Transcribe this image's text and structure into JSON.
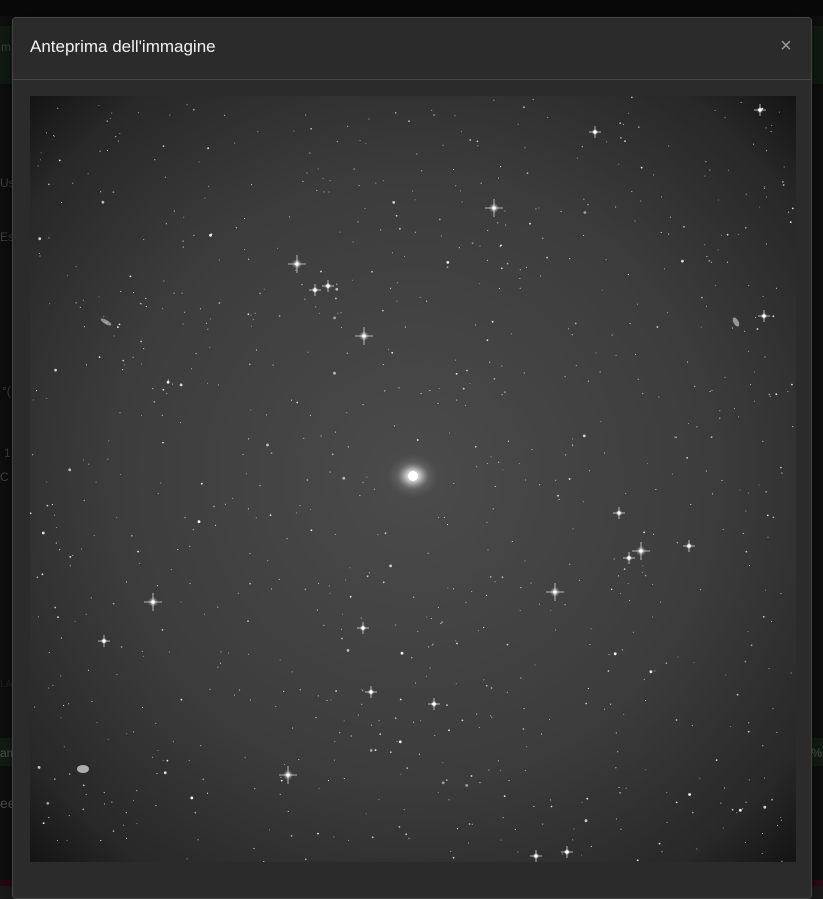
{
  "modal": {
    "title": "Anteprima dell'immagine",
    "close_symbol": "×"
  },
  "preview": {
    "alt": "Anteprima dell'immagine"
  },
  "background_fragments": {
    "left": [
      "m",
      "Us",
      "Es",
      "°(",
      "1",
      "C",
      "LA",
      "am",
      "ee"
    ],
    "right": [
      "%"
    ]
  },
  "colors": {
    "modal_bg": "#2b2b2b",
    "alert_green": "#28402c",
    "accent_magenta": "#8a1d3e"
  }
}
